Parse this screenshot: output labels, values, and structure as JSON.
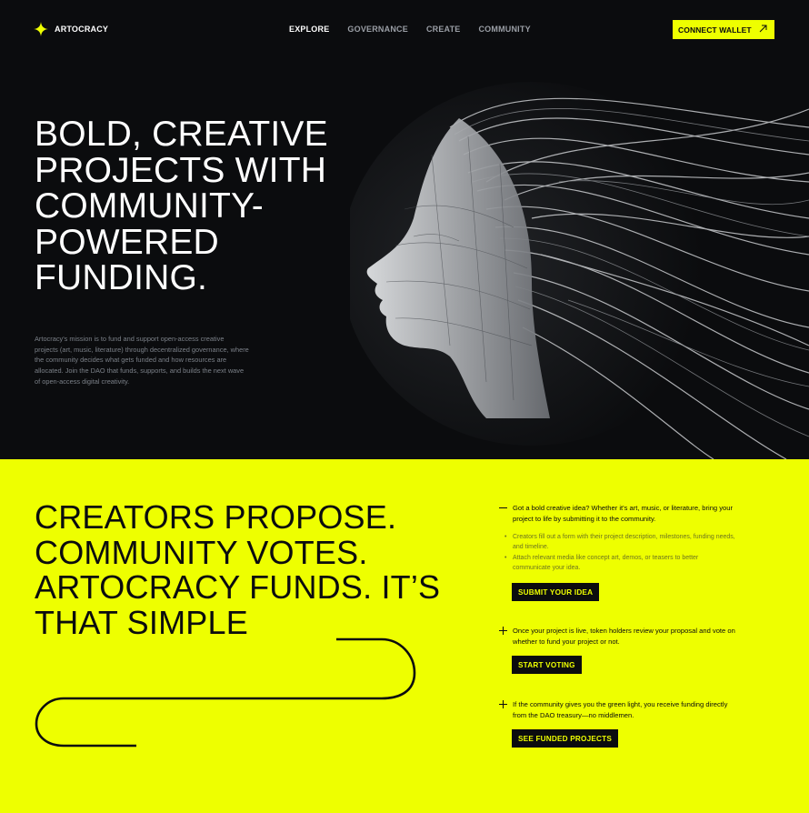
{
  "brand": {
    "name": "ARTOCRACY",
    "accent": "#eeff00",
    "dark": "#0b0c0e"
  },
  "nav": {
    "links": [
      {
        "label": "EXPLORE",
        "active": true
      },
      {
        "label": "GOVERNANCE",
        "active": false
      },
      {
        "label": "CREATE",
        "active": false
      },
      {
        "label": "COMMUNITY",
        "active": false
      }
    ],
    "wallet_label": "CONNECT WALLET",
    "wallet_icon": "arrow-up-right-icon"
  },
  "hero": {
    "headline": "BOLD, CREATIVE PROJECTS WITH COMMUNITY-POWERED FUNDING.",
    "mission": "Artocracy's mission is to fund and support open-access creative projects (art, music, literature) through decentralized governance, where the community decides what gets funded and how resources are allocated. Join the DAO that funds, supports, and builds the next wave of open-access digital creativity.",
    "image_icon": "digital-face-artwork"
  },
  "process": {
    "title": "CREATORS PROPOSE. COMMUNITY VOTES. ARTOCRACY FUNDS. IT’S THAT SIMPLE",
    "steps": [
      {
        "marker": "minus-icon",
        "text": "Got a bold creative idea? Whether it's art, music, or literature, bring your project to life by submitting it to the community.",
        "bullets": [
          "Creators fill out a form with their project description, milestones, funding needs, and timeline.",
          "Attach relevant media like concept art, demos, or teasers to better communicate your idea."
        ],
        "button": "SUBMIT YOUR IDEA"
      },
      {
        "marker": "plus-icon",
        "text": "Once your project is live, token holders review your proposal and vote on whether to fund your project or not.",
        "button": "START VOTING"
      },
      {
        "marker": "plus-icon",
        "text": "If the community gives you the green light, you receive funding directly from the DAO treasury—no middlemen.",
        "button": "SEE FUNDED PROJECTS"
      }
    ]
  }
}
